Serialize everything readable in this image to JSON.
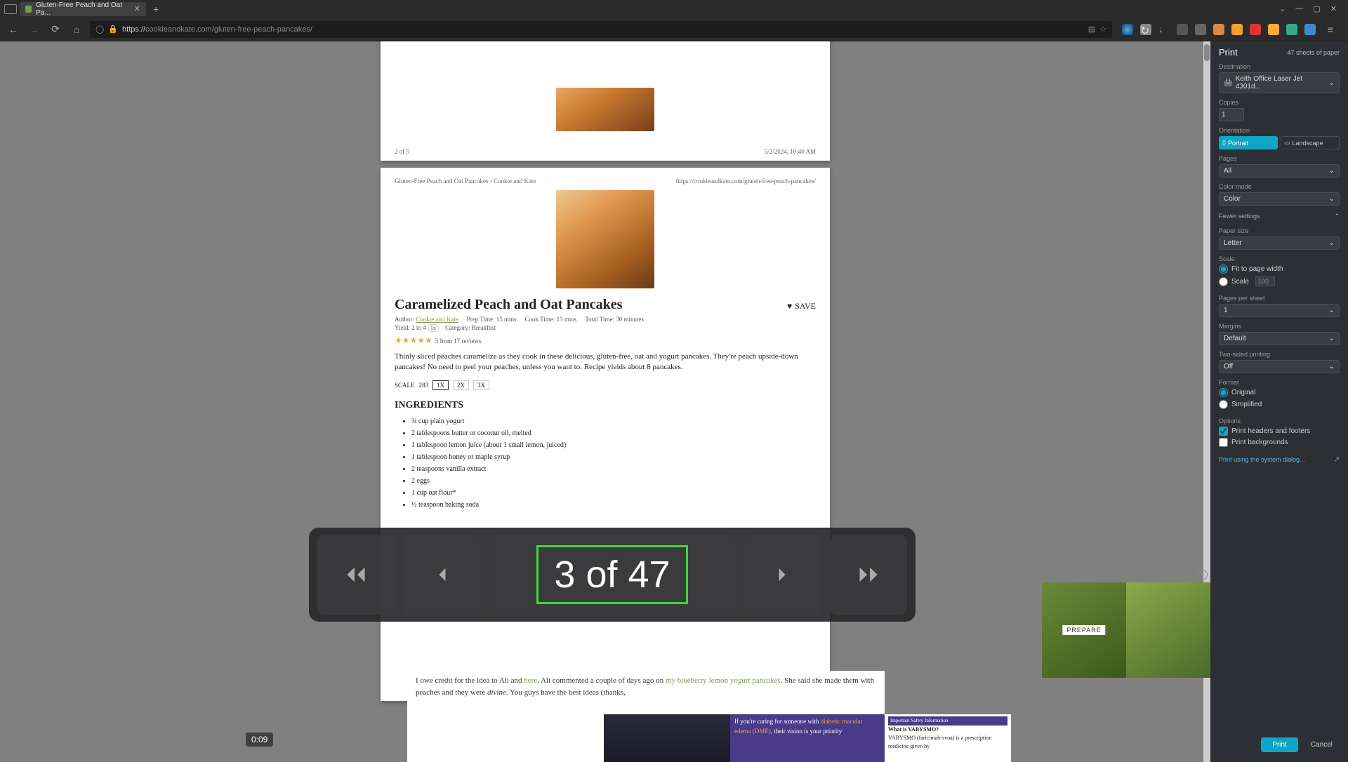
{
  "browser": {
    "tab_title": "Gluten-Free Peach and Oat Pa...",
    "url_host": "cookieandkate.com",
    "url_path": "/gluten-free-peach-pancakes/",
    "url_full": "https://cookieandkate.com/gluten-free-peach-pancakes/"
  },
  "preview": {
    "page_a": {
      "footer_left": "2 of 5",
      "footer_right": "5/2/2024, 10:40 AM"
    },
    "page_b": {
      "header_left": "Gluten-Free Peach and Oat Pancakes - Cookie and Kate",
      "header_right": "https://cookieandkate.com/gluten-free-peach-pancakes/",
      "title": "Caramelized Peach and Oat Pancakes",
      "author_label": "Author:",
      "author_link": "Cookie and Kate",
      "prep_label": "Prep Time:",
      "prep_val": "15 mins",
      "cook_label": "Cook Time:",
      "cook_val": "15 mins",
      "total_label": "Total Time:",
      "total_val": "30 minutes",
      "yield_label": "Yield:",
      "yield_val": "2 to 4",
      "yield_mult": "1x",
      "cat_label": "Category:",
      "cat_val": "Breakfast",
      "save": "SAVE",
      "stars": "★★★★★",
      "reviews": "5 from 17 reviews",
      "desc": "Thinly sliced peaches caramelize as they cook in these delicious, gluten-free, oat and yogurt pancakes. They're peach upside-down pancakes! No need to peel your peaches, unless you want to. Recipe yields about 8 pancakes.",
      "scale_label": "SCALE",
      "scale_1": "1X",
      "scale_2": "2X",
      "scale_3": "3X",
      "ing_head": "INGREDIENTS",
      "ingredients": [
        "¾ cup plain yogurt",
        "2 tablespoons butter or coconut oil, melted",
        "1 tablespoon lemon juice (about 1 small lemon, juiced)",
        "1 tablespoon honey or maple syrup",
        "2 teaspoons vanilla extract",
        "2 eggs",
        "1 cup oat flour*",
        "½ teaspoon baking soda"
      ]
    }
  },
  "pagenav": {
    "counter": "3 of 47"
  },
  "under": {
    "line1_pre": "I owe credit for the idea to Ali and ",
    "line1_link": "here",
    "line1_post": ". Ali commented a couple of days ago on ",
    "line2_link": "my blueberry lemon yogurt pancakes",
    "line2_post": ". She said she made them with peaches and they were ",
    "line2_em": "divine",
    "line2_tail": ". You guys have the best ideas (thanks,",
    "ad": {
      "caring": "If you're caring for someone with ",
      "dme": "diabetic macular edema (DME)",
      "vision": ", their vision is your priority",
      "isi": "Important Safety Information",
      "what": "What is VABYSMO?",
      "body": "VABYSMO (faricimab-svoa) is a prescription medicine given by"
    }
  },
  "timebadge": "0:09",
  "thumb": {
    "label": "PREPARE"
  },
  "panel": {
    "title": "Print",
    "sheets": "47 sheets of paper",
    "dest_label": "Destination",
    "dest_value": "Keith Office Laser Jet 4301d...",
    "copies_label": "Copies",
    "copies_value": "1",
    "orient_label": "Orientation",
    "orient_portrait": "Portrait",
    "orient_landscape": "Landscape",
    "pages_label": "Pages",
    "pages_value": "All",
    "color_label": "Color mode",
    "color_value": "Color",
    "fewer": "Fewer settings",
    "paper_label": "Paper size",
    "paper_value": "Letter",
    "scale_label": "Scale",
    "scale_fit": "Fit to page width",
    "scale_custom": "Scale",
    "scale_num": "100",
    "pps_label": "Pages per sheet",
    "pps_value": "1",
    "margins_label": "Margins",
    "margins_value": "Default",
    "twosided_label": "Two-sided printing",
    "twosided_value": "Off",
    "format_label": "Format",
    "format_orig": "Original",
    "format_simp": "Simplified",
    "options_label": "Options",
    "opt_headers": "Print headers and footers",
    "opt_bg": "Print backgrounds",
    "sys_link": "Print using the system dialog...",
    "btn_print": "Print",
    "btn_cancel": "Cancel"
  }
}
